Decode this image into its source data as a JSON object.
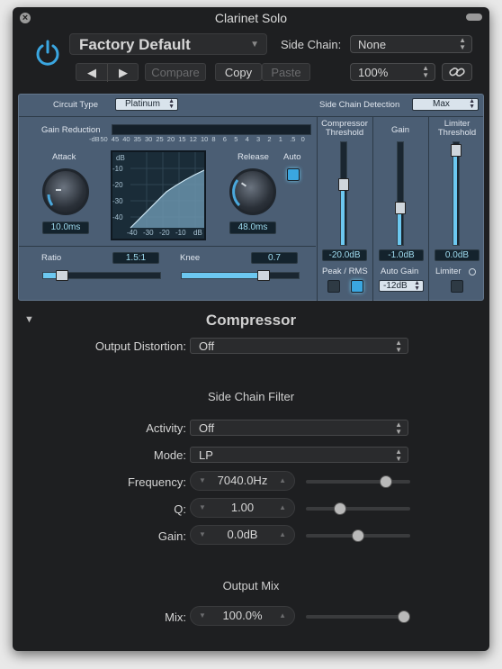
{
  "window": {
    "title": "Clarinet Solo"
  },
  "header": {
    "preset": "Factory Default",
    "side_chain_label": "Side Chain:",
    "side_chain_value": "None",
    "compare": "Compare",
    "copy": "Copy",
    "paste": "Paste",
    "zoom": "100%"
  },
  "plugin": {
    "circuit_type_label": "Circuit Type",
    "circuit_type_value": "Platinum",
    "sc_detection_label": "Side Chain Detection",
    "sc_detection_value": "Max",
    "gain_reduction_label": "Gain Reduction",
    "gr_scale": [
      "-dB",
      "50",
      "45",
      "40",
      "35",
      "30",
      "25",
      "20",
      "15",
      "12",
      "10",
      "8",
      "6",
      "5",
      "4",
      "3",
      "2",
      "1",
      ".5",
      "0"
    ],
    "attack_label": "Attack",
    "attack_value": "10.0ms",
    "release_label": "Release",
    "release_value": "48.0ms",
    "auto_label": "Auto",
    "graph_db": "dB",
    "graph_y": [
      "-10",
      "-20",
      "-30",
      "-40"
    ],
    "graph_x": [
      "-40",
      "-30",
      "-20",
      "-10",
      "dB"
    ],
    "ratio_label": "Ratio",
    "ratio_value": "1.5:1",
    "knee_label": "Knee",
    "knee_value": "0.7",
    "threshold_label": "Compressor Threshold",
    "threshold_value": "-20.0dB",
    "peak_rms_label": "Peak / RMS",
    "gain_label": "Gain",
    "gain_value": "-1.0dB",
    "auto_gain_label": "Auto Gain",
    "auto_gain_value": "-12dB",
    "limiter_threshold_label": "Limiter Threshold",
    "limiter_threshold_value": "0.0dB",
    "limiter_label": "Limiter"
  },
  "section": {
    "title": "Compressor",
    "output_distortion_label": "Output Distortion:",
    "output_distortion_value": "Off",
    "sc_filter_heading": "Side Chain Filter",
    "activity_label": "Activity:",
    "activity_value": "Off",
    "mode_label": "Mode:",
    "mode_value": "LP",
    "frequency_label": "Frequency:",
    "frequency_value": "7040.0Hz",
    "frequency_level": 0.8,
    "q_label": "Q:",
    "q_value": "1.00",
    "q_level": 0.3,
    "gain_label": "Gain:",
    "gain_value": "0.0dB",
    "gain_level": 0.5,
    "output_mix_heading": "Output Mix",
    "mix_label": "Mix:",
    "mix_value": "100.0%",
    "mix_level": 1.0
  }
}
